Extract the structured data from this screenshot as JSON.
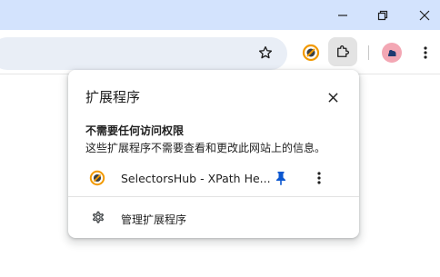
{
  "window": {
    "minimize_icon": "minimize-icon",
    "restore_icon": "restore-icon",
    "close_icon": "close-icon"
  },
  "toolbar": {
    "bookmark_icon": "star-icon",
    "pinned_extension_icon": "selectorshub-icon",
    "extensions_icon": "puzzle-icon",
    "profile_icon": "avatar",
    "menu_icon": "more-vert-icon"
  },
  "popup": {
    "title": "扩展程序",
    "section_heading": "不需要任何访问权限",
    "section_description": "这些扩展程序不需要查看和更改此网站上的信息。",
    "extensions": [
      {
        "name": "SelectorsHub - XPath He...",
        "pinned": true
      }
    ],
    "manage_label": "管理扩展程序"
  },
  "colors": {
    "titlebar": "#d3e3fd",
    "omnibox": "#e9eef6",
    "pin_blue": "#0b57d0",
    "avatar_bg": "#f3a7b4"
  }
}
